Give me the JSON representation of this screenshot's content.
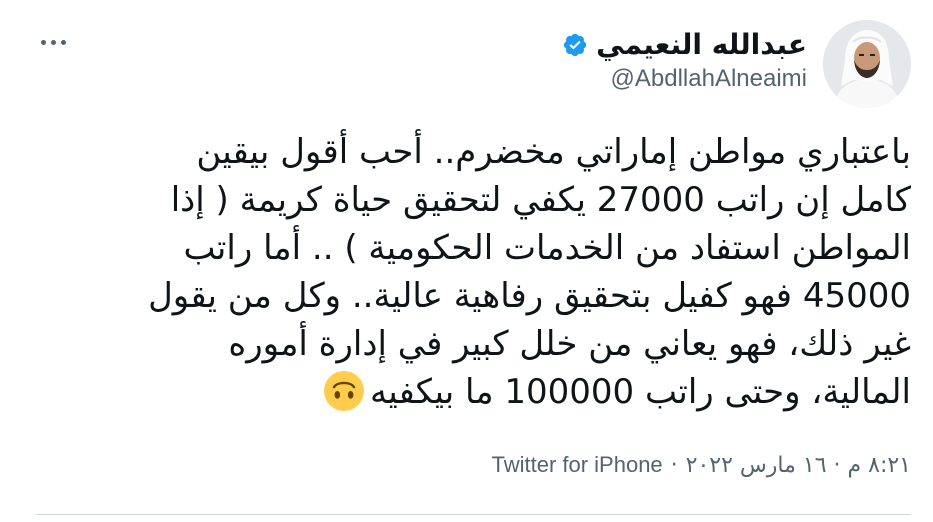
{
  "author": {
    "display_name": "عبدالله النعيمي",
    "handle": "@AbdllahAlneaimi",
    "verified": true
  },
  "tweet": {
    "lines": [
      "باعتباري مواطن إماراتي مخضرم.. أحب أقول بيقين",
      "كامل إن راتب 27000 يكفي لتحقيق حياة كريمة ( إذا",
      "المواطن استفاد من الخدمات الحكومية ) .. أما راتب",
      "45000 فهو كفيل بتحقيق رفاهية عالية.. وكل من يقول",
      "غير ذلك، فهو يعاني من خلل كبير في إدارة أموره",
      "المالية، وحتى راتب 100000 ما بيكفيه"
    ],
    "emoji": "upside-down-face-emoji"
  },
  "meta": {
    "timestamp": "٨:٢١ م · ١٦ مارس ٢٠٢٢",
    "separator": "·",
    "source": "Twitter for iPhone"
  },
  "colors": {
    "text": "#0f1419",
    "secondary": "#536471",
    "verified_blue": "#1d9bf0",
    "emoji_yellow": "#ffcc4d"
  },
  "icons": {
    "more": "more-horizontal-icon",
    "verified": "verified-badge-icon"
  }
}
